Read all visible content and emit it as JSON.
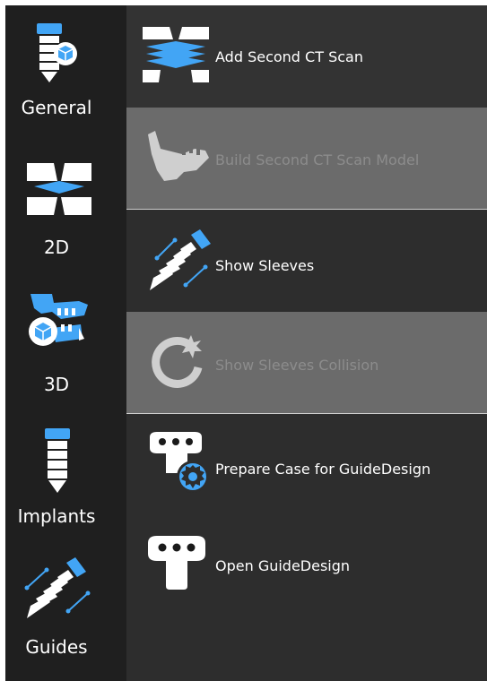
{
  "sidebar": {
    "items": [
      {
        "label": "General",
        "icon": "implant-cube-icon"
      },
      {
        "label": "2D",
        "icon": "ct-slices-icon"
      },
      {
        "label": "3D",
        "icon": "jaw-cube-icon"
      },
      {
        "label": "Implants",
        "icon": "implant-icon"
      },
      {
        "label": "Guides",
        "icon": "sleeve-icon"
      }
    ]
  },
  "actions": [
    {
      "label": "Add Second CT Scan",
      "icon": "ct-slices-icon",
      "state": "enabled"
    },
    {
      "label": "Build Second CT Scan Model",
      "icon": "jaw-icon",
      "state": "disabled"
    },
    {
      "label": "Show Sleeves",
      "icon": "sleeve-icon",
      "state": "enabled"
    },
    {
      "label": "Show Sleeves Collision",
      "icon": "collision-icon",
      "state": "disabled"
    },
    {
      "label": "Prepare Case for GuideDesign",
      "icon": "guide-gear-icon",
      "state": "enabled"
    },
    {
      "label": "Open GuideDesign",
      "icon": "guide-icon",
      "state": "enabled"
    }
  ],
  "colors": {
    "accent_blue": "#42a5f5",
    "icon_white": "#ffffff",
    "sidebar_bg": "#1f1f1f",
    "panel_bg": "#2d2d2d",
    "disabled_bg": "#6b6b6b",
    "disabled_text": "#8c8c8c"
  }
}
